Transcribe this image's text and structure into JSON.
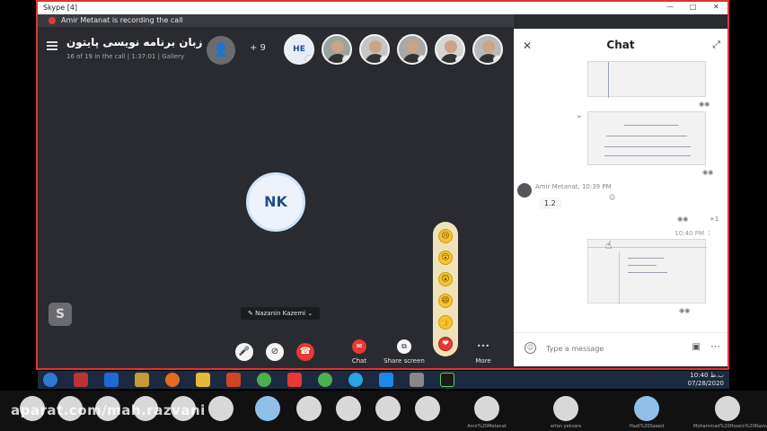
{
  "window": {
    "title": "Skype [4]",
    "controls": [
      "—",
      "□",
      "✕"
    ]
  },
  "recording": {
    "text": "Amir Metanat is recording the call"
  },
  "call": {
    "title": "زبان برنامه نویسی پایتون",
    "subtitle": "16 of 19 in the call | 1:37:01 | Gallery",
    "more_participants": "+ 9",
    "avatar_initials": "HE",
    "participant_initials": "NK",
    "speaker_name": "Nazanin Kazemi"
  },
  "controls": {
    "chat_label": "Chat",
    "share_label": "Share screen",
    "more_label": "More",
    "more_glyph": "•••"
  },
  "reactions": [
    "😢",
    "😮",
    "😲",
    "😄",
    "👍",
    "❤"
  ],
  "chat": {
    "title": "Chat",
    "messages": [
      {
        "sender": "Amir Metanat, 10:39 PM",
        "text": "1.2"
      },
      {
        "time": "10:40 PM"
      }
    ],
    "reaction_count": "+1",
    "composer_placeholder": "Type a message"
  },
  "taskbar": {
    "time": "10:40 ب.ظ",
    "date": "07/28/2020"
  },
  "bottom_strip": {
    "names": [
      "Amir%20Metanat",
      "erfan yekzare",
      "Hadi%20Saeed",
      "Mohammad%20Hosein%20Razvani"
    ]
  },
  "watermark": {
    "text": "aparat.com/mah.razvani"
  },
  "colors": {
    "accent": "#e53935",
    "chat_bg": "#ffffff",
    "call_bg": "#2a2b30"
  }
}
